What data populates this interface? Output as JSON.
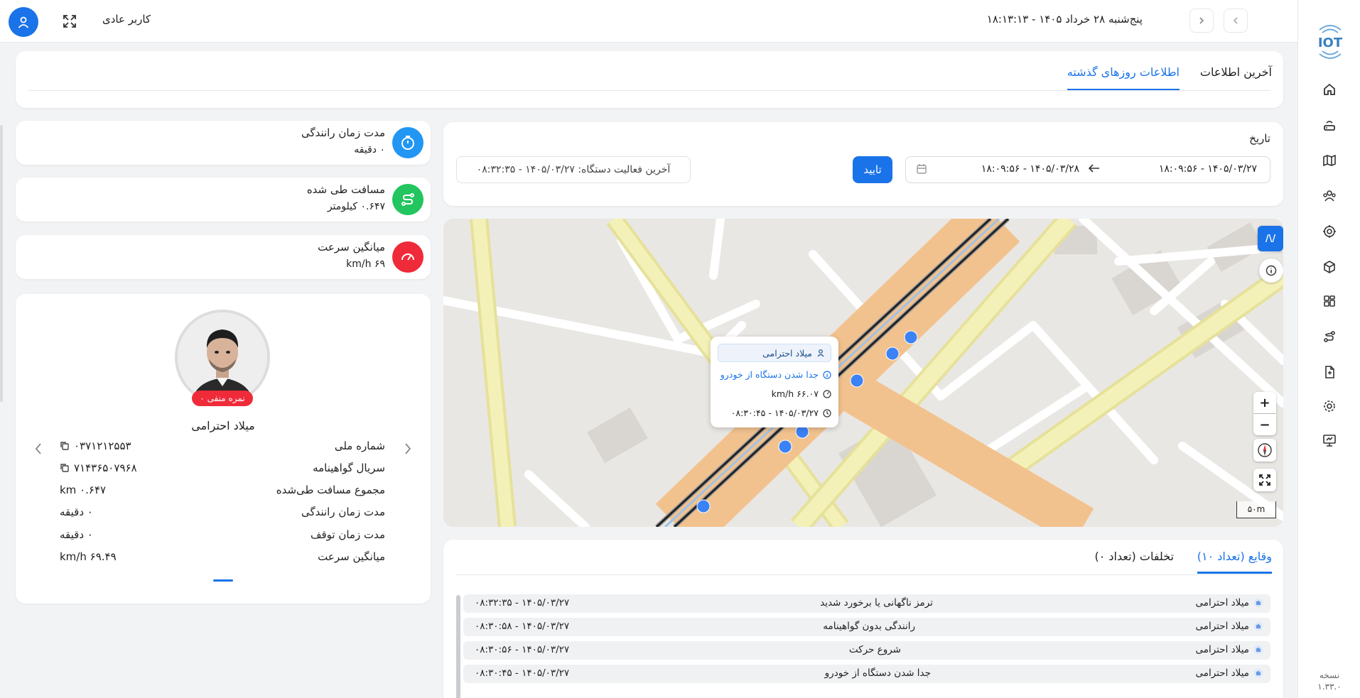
{
  "topbar": {
    "user_label": "کاربر عادی",
    "date_time": "پنج‌شنبه ۲۸ خرداد ۱۴۰۵ - ۱۸:۱۳:۱۳"
  },
  "sidebar": {
    "logo_text": "IOT",
    "version_label": "نسخه",
    "version_number": "۱.۳۳.۰"
  },
  "tabs": [
    {
      "label": "آخرین اطلاعات",
      "active": false
    },
    {
      "label": "اطلاعات روزهای گذشته",
      "active": true
    }
  ],
  "filter": {
    "title": "تاریخ",
    "range_start": "۱۴۰۵/۰۳/۲۷ - ۱۸:۰۹:۵۶",
    "range_end": "۱۴۰۵/۰۳/۲۸ - ۱۸:۰۹:۵۶",
    "confirm_label": "تایید",
    "last_activity": "آخرین فعالیت دستگاه: ۱۴۰۵/۰۳/۲۷ - ۰۸:۳۲:۳۵"
  },
  "map": {
    "popup": {
      "driver": "میلاد احترامی",
      "event": "جدا شدن دستگاه از خودرو",
      "speed": "۶۶.۰۷ km/h",
      "time": "۱۴۰۵/۰۳/۲۷ - ۰۸:۳۰:۴۵"
    },
    "layer_btn": "/\\/",
    "zoom_in": "+",
    "zoom_out": "−",
    "scale": "۵۰m"
  },
  "stats": [
    {
      "label": "مدت زمان رانندگی",
      "value": "۰ دقیقه",
      "color": "#2196f3"
    },
    {
      "label": "مسافت طی شده",
      "value": "۰.۶۴۷ کیلومتر",
      "color": "#22c55e"
    },
    {
      "label": "میانگین سرعت",
      "value": "۶۹ km/h",
      "color": "#ef2b3a"
    }
  ],
  "driver": {
    "badge": "نمره منفی ۰",
    "name": "میلاد احترامی",
    "rows": [
      {
        "key": "شماره ملی",
        "value": "۰۳۷۱۲۱۲۵۵۳"
      },
      {
        "key": "سریال گواهینامه",
        "value": "۷۱۴۳۶۵۰۷۹۶۸"
      },
      {
        "key": "مجموع مسافت طی‌شده",
        "value": "۰.۶۴۷ km"
      },
      {
        "key": "مدت زمان رانندگی",
        "value": "۰ دقیقه"
      },
      {
        "key": "مدت زمان توقف",
        "value": "۰ دقیقه"
      },
      {
        "key": "میانگین سرعت",
        "value": "۶۹.۴۹ km/h"
      }
    ]
  },
  "events": {
    "tabs": [
      {
        "label": "وقایع (تعداد ۱۰)",
        "active": true
      },
      {
        "label": "تخلفات (تعداد ۰)",
        "active": false
      }
    ],
    "rows": [
      {
        "driver": "میلاد احترامی",
        "event": "ترمز ناگهانی یا برخورد شدید",
        "time": "۱۴۰۵/۰۳/۲۷ - ۰۸:۳۲:۳۵"
      },
      {
        "driver": "میلاد احترامی",
        "event": "رانندگی بدون گواهینامه",
        "time": "۱۴۰۵/۰۳/۲۷ - ۰۸:۳۰:۵۸"
      },
      {
        "driver": "میلاد احترامی",
        "event": "شروع حرکت",
        "time": "۱۴۰۵/۰۳/۲۷ - ۰۸:۳۰:۵۶"
      },
      {
        "driver": "میلاد احترامی",
        "event": "جدا شدن دستگاه از خودرو",
        "time": "۱۴۰۵/۰۳/۲۷ - ۰۸:۳۰:۴۵"
      }
    ]
  }
}
